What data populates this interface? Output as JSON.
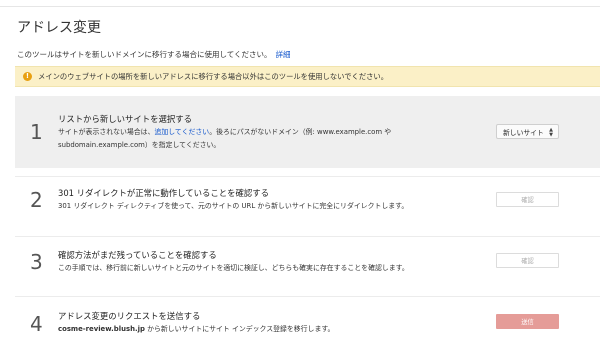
{
  "page": {
    "title": "アドレス変更",
    "intro_text": "このツールはサイトを新しいドメインに移行する場合に使用してください。",
    "intro_link": "詳細"
  },
  "warning": {
    "icon": "warning-icon",
    "text": "メインのウェブサイトの場所を新しいアドレスに移行する場合以外はこのツールを使用しないでください。"
  },
  "steps": [
    {
      "number": "1",
      "title": "リストから新しいサイトを選択する",
      "desc_before_link": "サイトが表示されない場合は、",
      "desc_link": "追加してください",
      "desc_after_link": "。後ろにパスがないドメイン（例: www.example.com や",
      "desc_line2": "subdomain.example.com）を指定してください。",
      "control": "新しいサイト"
    },
    {
      "number": "2",
      "title": "301 リダイレクトが正常に動作していることを確認する",
      "desc": "301 リダイレクト ディレクティブを使って、元のサイトの URL から新しいサイトに完全にリダイレクトします。",
      "button": "確認"
    },
    {
      "number": "3",
      "title": "確認方法がまだ残っていることを確認する",
      "desc": "この手順では、移行前に新しいサイトと元のサイトを適切に検証し、どちらも確実に存在することを確認します。",
      "button": "確認"
    },
    {
      "number": "4",
      "title": "アドレス変更のリクエストを送信する",
      "desc_bold": "cosme-review.blush.jp",
      "desc_rest": " から新しいサイトにサイト インデックス登録を移行します。",
      "button": "送信"
    }
  ],
  "colors": {
    "warning_bg": "#fbf0c7",
    "warning_icon": "#e8a012",
    "link": "#1155cc",
    "active_step_bg": "#efefef",
    "send_button": "#e59c98"
  }
}
